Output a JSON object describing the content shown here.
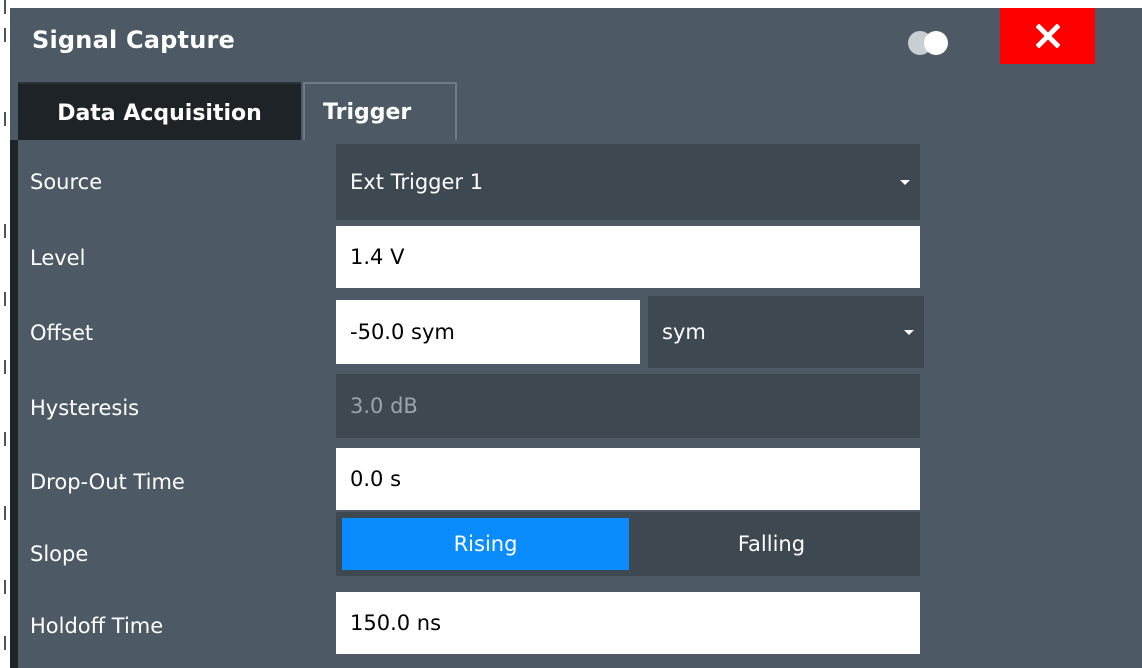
{
  "dialog": {
    "title": "Signal Capture"
  },
  "tabs": [
    {
      "label": "Data Acquisition",
      "active": false
    },
    {
      "label": "Trigger",
      "active": true
    }
  ],
  "fields": {
    "source": {
      "label": "Source",
      "value": "Ext Trigger 1"
    },
    "level": {
      "label": "Level",
      "value": "1.4 V"
    },
    "offset": {
      "label": "Offset",
      "value": "-50.0 sym",
      "unit": "sym"
    },
    "hysteresis": {
      "label": "Hysteresis",
      "value": "3.0 dB"
    },
    "dropout": {
      "label": "Drop-Out Time",
      "value": "0.0 s"
    },
    "slope": {
      "label": "Slope",
      "options": [
        "Rising",
        "Falling"
      ],
      "selected": "Rising"
    },
    "holdoff": {
      "label": "Holdoff Time",
      "value": "150.0 ns"
    }
  },
  "colors": {
    "titlebar": "#4d5a66",
    "close": "#ff0000",
    "accent": "#0a8cff"
  },
  "icons": {
    "toggle": "toggle-icon",
    "close": "close-icon",
    "dropdown": "chevron-down-icon"
  }
}
